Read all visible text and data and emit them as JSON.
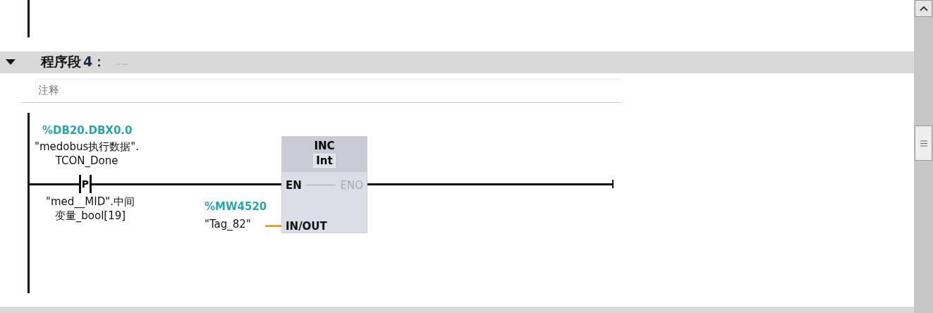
{
  "network": {
    "expanded": true,
    "label": "程序段",
    "number": "4：",
    "title": "....."
  },
  "comment": {
    "placeholder": "注释"
  },
  "contact": {
    "address": "%DB20.DBX0.0",
    "operand": "\"medobus执行数据\".TCON_Done",
    "type": "P",
    "edge_operand": "\"med__MID\".中间变量_bool[19]"
  },
  "box": {
    "name": "INC",
    "data_type": "Int",
    "pins": [
      {
        "kind": "input",
        "name": "EN",
        "disabled": false
      },
      {
        "kind": "output",
        "name": "ENO",
        "disabled": true
      },
      {
        "kind": "inout",
        "name": "IN/OUT",
        "disabled": false
      }
    ]
  },
  "in_out": {
    "address": "%MW4520",
    "operand": "\"Tag_82\""
  }
}
